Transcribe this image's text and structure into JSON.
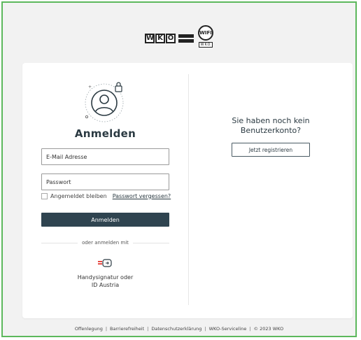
{
  "header": {
    "wko_logo_text": [
      "W",
      "K",
      "O"
    ],
    "wifi_logo_text": "WIFI",
    "wifi_logo_sub": "WKO"
  },
  "login": {
    "title": "Anmelden",
    "email_placeholder": "E-Mail Adresse",
    "password_placeholder": "Passwort",
    "remember_label": "Angemeldet bleiben",
    "forgot_link": "Passwort vergessen?",
    "submit_label": "Anmelden",
    "alt_login_label": "oder anmelden mit",
    "handy_line1": "Handysignatur oder",
    "handy_line2": "ID Austria"
  },
  "register": {
    "line1": "Sie haben noch kein",
    "line2": "Benutzerkonto?",
    "button_label": "Jetzt registrieren"
  },
  "footer": {
    "links": [
      "Offenlegung",
      "Barrierefreiheit",
      "Datenschutzerklärung",
      "WKO-Serviceline"
    ],
    "copyright": "© 2023 WKO",
    "separator": "|"
  },
  "colors": {
    "frame_border": "#5cb85c",
    "primary": "#2f4450",
    "background": "#f2f2f2",
    "icon_red": "#e2231a"
  },
  "icons": {
    "avatar": "user-circle-icon",
    "lock": "lock-icon",
    "handy": "mobile-signature-icon"
  }
}
